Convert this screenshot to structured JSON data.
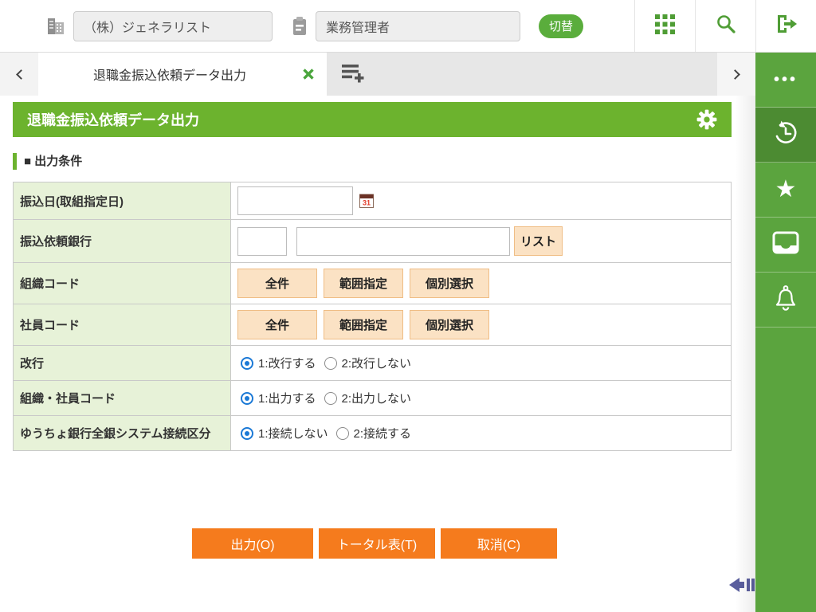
{
  "topbar": {
    "company_value": "（株）ジェネラリスト",
    "role_value": "業務管理者",
    "switch_button": "切替",
    "icons": [
      "building-icon",
      "clipboard-icon",
      "grid-menu-icon",
      "search-icon",
      "logout-icon"
    ]
  },
  "tabbar": {
    "active_tab_title": "退職金振込依頼データ出力",
    "icons": [
      "prev-tab-chevron",
      "close-tab-icon",
      "add-tab-icon",
      "next-tab-chevron"
    ]
  },
  "page": {
    "title": "退職金振込依頼データ出力",
    "section_heading": "■ 出力条件"
  },
  "form": {
    "rows": [
      {
        "label": "振込日(取組指定日)",
        "type": "date",
        "value": "",
        "icon": "calendar-icon"
      },
      {
        "label": "振込依頼銀行",
        "type": "bank-lookup",
        "code_value": "",
        "name_value": "",
        "list_button": "リスト"
      },
      {
        "label": "組織コード",
        "type": "buttons",
        "buttons": [
          "全件",
          "範囲指定",
          "個別選択"
        ]
      },
      {
        "label": "社員コード",
        "type": "buttons",
        "buttons": [
          "全件",
          "範囲指定",
          "個別選択"
        ]
      },
      {
        "label": "改行",
        "type": "radio",
        "options": [
          {
            "label": "1:改行する",
            "selected": true
          },
          {
            "label": "2:改行しない",
            "selected": false
          }
        ]
      },
      {
        "label": "組織・社員コード",
        "type": "radio",
        "options": [
          {
            "label": "1:出力する",
            "selected": true
          },
          {
            "label": "2:出力しない",
            "selected": false
          }
        ]
      },
      {
        "label": "ゆうちょ銀行全銀システム接続区分",
        "type": "radio",
        "options": [
          {
            "label": "1:接続しない",
            "selected": true
          },
          {
            "label": "2:接続する",
            "selected": false
          }
        ]
      }
    ]
  },
  "actions": [
    {
      "label": "出力(O)"
    },
    {
      "label": "トータル表(T)"
    },
    {
      "label": "取消(C)"
    }
  ],
  "sidebar": {
    "items": [
      {
        "icon": "more-ellipsis-icon"
      },
      {
        "icon": "history-icon",
        "active": true
      },
      {
        "icon": "favorite-star-icon"
      },
      {
        "icon": "tray-icon"
      },
      {
        "icon": "notification-bell-icon"
      }
    ]
  },
  "colors": {
    "page_header_green": "#6cb32e",
    "sidebar_green": "#5ba43e",
    "sidebar_active_green": "#4c8b32",
    "action_orange": "#f57b1d",
    "peach_button_bg": "#fbe2c4",
    "peach_button_border": "#efbd85",
    "radio_selected_blue": "#1b79d6",
    "label_cell_green": "#e7f2d8",
    "collapse_arrow_blue": "#5b5f9e"
  }
}
